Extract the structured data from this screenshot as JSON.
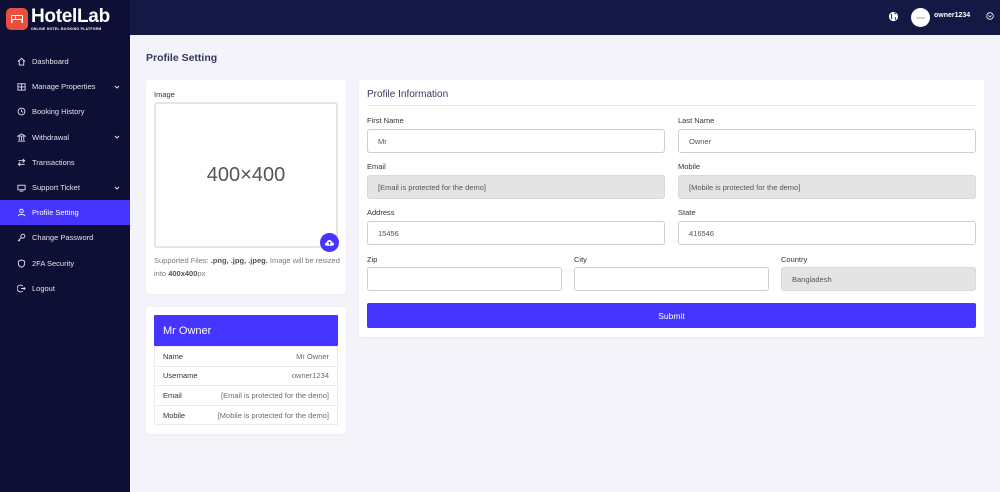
{
  "brand": {
    "name": "HotelLab",
    "tagline": "ONLINE HOTEL BOOKING PLATFORM"
  },
  "sidebar": {
    "items": [
      {
        "label": "Dashboard",
        "icon": "home-icon"
      },
      {
        "label": "Manage Properties",
        "icon": "building-icon",
        "has_submenu": true
      },
      {
        "label": "Booking History",
        "icon": "history-icon"
      },
      {
        "label": "Withdrawal",
        "icon": "bank-icon",
        "has_submenu": true
      },
      {
        "label": "Transactions",
        "icon": "exchange-icon"
      },
      {
        "label": "Support Ticket",
        "icon": "ticket-icon",
        "has_submenu": true
      },
      {
        "label": "Profile Setting",
        "icon": "user-icon",
        "active": true
      },
      {
        "label": "Change Password",
        "icon": "key-icon"
      },
      {
        "label": "2FA Security",
        "icon": "shield-icon"
      },
      {
        "label": "Logout",
        "icon": "logout-icon"
      }
    ]
  },
  "topbar": {
    "username": "owner1234"
  },
  "page": {
    "title": "Profile Setting"
  },
  "image_card": {
    "label": "Image",
    "placeholder": "400×400",
    "help_prefix": "Supported Files: ",
    "help_types": ".png, .jpg, .jpeg.",
    "help_middle": " Image will be resized into ",
    "help_size": "400x400",
    "help_suffix": "px"
  },
  "owner_card": {
    "name": "Mr Owner",
    "rows": [
      {
        "key": "Name",
        "value": "Mr Owner"
      },
      {
        "key": "Username",
        "value": "owner1234"
      },
      {
        "key": "Email",
        "value": "[Email is protected for the demo]"
      },
      {
        "key": "Mobile",
        "value": "[Mobile is protected for the demo]"
      }
    ]
  },
  "form": {
    "title": "Profile Information",
    "first_name": {
      "label": "First Name",
      "value": "Mr"
    },
    "last_name": {
      "label": "Last Name",
      "value": "Owner"
    },
    "email": {
      "label": "Email",
      "value": "[Email is protected for the demo]"
    },
    "mobile": {
      "label": "Mobile",
      "value": "[Mobile is protected for the demo]"
    },
    "address": {
      "label": "Address",
      "value": "15456"
    },
    "state": {
      "label": "State",
      "value": "416546"
    },
    "zip": {
      "label": "Zip",
      "value": ""
    },
    "city": {
      "label": "City",
      "value": ""
    },
    "country": {
      "label": "Country",
      "value": "Bangladesh"
    },
    "submit_label": "Submit"
  },
  "colors": {
    "primary": "#4634ff",
    "sidebar": "#0d1034",
    "topbar": "#131845",
    "background": "#f3f3f9",
    "logo": "#e8503e"
  }
}
